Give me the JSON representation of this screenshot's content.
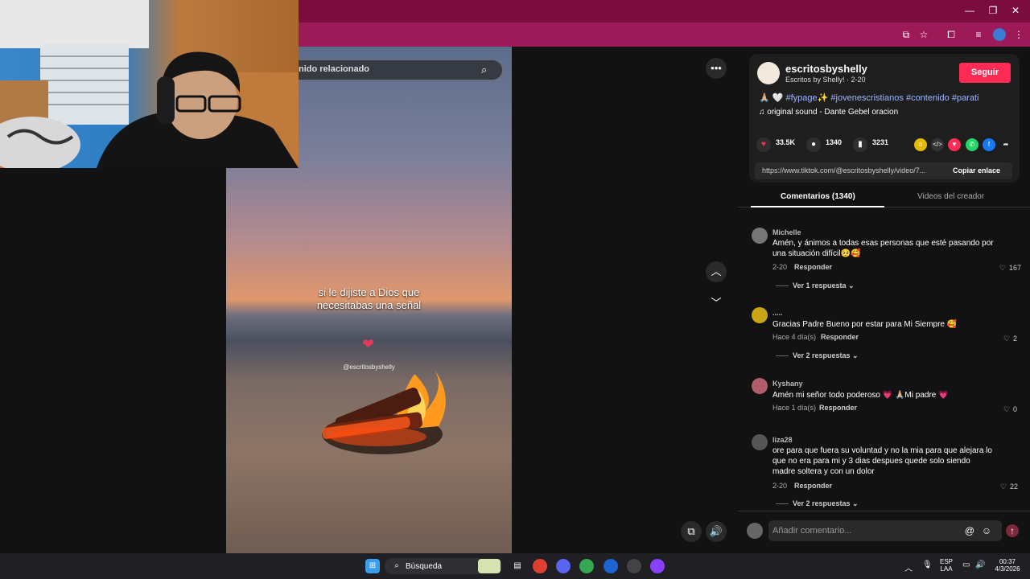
{
  "browser": {
    "min_icon": "minimize-icon",
    "max_icon": "maximize-icon",
    "close_icon": "close-icon"
  },
  "video": {
    "search_text": "nido relacionado",
    "caption_line1": "si le dijiste a Dios que",
    "caption_line2": "necesitabas una señal",
    "watermark": "@escritosbyshelly"
  },
  "creator": {
    "username": "escritosbyshelly",
    "subtitle": "Escritos by Shelly! · 2-20",
    "follow_label": "Seguir",
    "hashtags": "🙏🏼 🤍 #fypage✨ #jovenescristianos #contenido #parati",
    "sound": "♫  original sound - Dante Gebel oracion"
  },
  "stats": {
    "likes": "33.5K",
    "comments": "1340",
    "saves": "3231"
  },
  "share": {
    "url": "https://www.tiktok.com/@escritosbyshelly/video/7...",
    "copy_label": "Copiar enlace"
  },
  "tabs": {
    "comments": "Comentarios (1340)",
    "creator_videos": "Videos del creador"
  },
  "comments": [
    {
      "name": "Michelle",
      "text": "Amén, y ánimos a todas esas personas que esté pasando por una situación difícil🥺🥰",
      "date": "2-20",
      "reply": "Responder",
      "likes": "167",
      "more": "Ver 1 respuesta ⌄"
    },
    {
      "name": ".....",
      "text": "Gracias Padre Bueno por estar para Mi Siempre 🥰",
      "date": "Hace 4 día(s)",
      "reply": "Responder",
      "likes": "2",
      "more": "Ver 2 respuestas ⌄"
    },
    {
      "name": "Kyshany",
      "text": "Amén mi señor todo poderoso 💗 🙏🏼Mi padre 💗",
      "date": "Hace 1 día(s)",
      "reply": "Responder",
      "likes": "0",
      "more": ""
    },
    {
      "name": "liza28",
      "text": "ore para que fuera su voluntad y no la mia para que alejara lo que no era para mi y 3 dias despues quede solo siendo madre soltera y con un dolor",
      "date": "2-20",
      "reply": "Responder",
      "likes": "22",
      "more": "Ver 2 respuestas ⌄"
    }
  ],
  "composer": {
    "placeholder": "Añadir comentario..."
  },
  "taskbar": {
    "search_label": "Búsqueda",
    "lang1": "ESP",
    "lang2": "LAA",
    "time": "00:37",
    "date": "4/3/2026"
  },
  "colors": {
    "titlebar": "#7a0d3e",
    "toolbar": "#9c1a57",
    "follow": "#fe2c55",
    "hashtag": "#9fb6ff"
  }
}
